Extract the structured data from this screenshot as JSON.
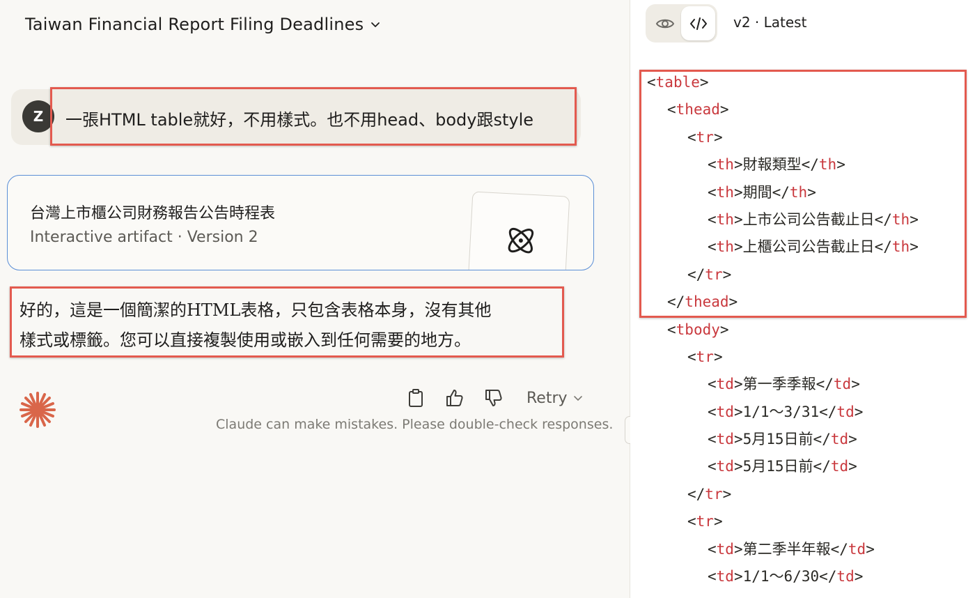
{
  "header": {
    "title": "Taiwan Financial Report Filing Deadlines"
  },
  "user_message": {
    "avatar_initial": "Z",
    "text": "一張HTML table就好，不用樣式。也不用head、body跟style"
  },
  "artifact_card": {
    "title": "台灣上市櫃公司財務報告公告時程表",
    "subtitle": "Interactive artifact · Version 2"
  },
  "assistant_message": {
    "lines": [
      "好的，這是一個簡潔的HTML表格，只包含表格本身，沒有其他",
      "樣式或標籤。您可以直接複製使用或嵌入到任何需要的地方。"
    ]
  },
  "actions": {
    "retry_label": "Retry",
    "disclaimer": "Claude can make mistakes. Please double-check responses.",
    "icons": [
      "copy-icon",
      "thumbs-up-icon",
      "thumbs-down-icon"
    ]
  },
  "code_panel": {
    "version_label": "v2 · Latest",
    "code_lines": [
      {
        "indent": 0,
        "open": true,
        "tag": "table"
      },
      {
        "indent": 1,
        "open": true,
        "tag": "thead"
      },
      {
        "indent": 2,
        "open": true,
        "tag": "tr"
      },
      {
        "indent": 3,
        "tag": "th",
        "text": "財報類型"
      },
      {
        "indent": 3,
        "tag": "th",
        "text": "期間"
      },
      {
        "indent": 3,
        "tag": "th",
        "text": "上市公司公告截止日"
      },
      {
        "indent": 3,
        "tag": "th",
        "text": "上櫃公司公告截止日"
      },
      {
        "indent": 2,
        "close": true,
        "tag": "tr"
      },
      {
        "indent": 1,
        "close": true,
        "tag": "thead"
      },
      {
        "indent": 1,
        "open": true,
        "tag": "tbody"
      },
      {
        "indent": 2,
        "open": true,
        "tag": "tr"
      },
      {
        "indent": 3,
        "tag": "td",
        "text": "第一季季報"
      },
      {
        "indent": 3,
        "tag": "td",
        "text": "1/1～3/31"
      },
      {
        "indent": 3,
        "tag": "td",
        "text": "5月15日前"
      },
      {
        "indent": 3,
        "tag": "td",
        "text": "5月15日前"
      },
      {
        "indent": 2,
        "close": true,
        "tag": "tr"
      },
      {
        "indent": 2,
        "open": true,
        "tag": "tr"
      },
      {
        "indent": 3,
        "tag": "td",
        "text": "第二季半年報"
      },
      {
        "indent": 3,
        "tag": "td",
        "text": "1/1～6/30"
      }
    ]
  },
  "colors": {
    "accent_highlight": "#e35a4f",
    "artifact_border": "#5a8ed6",
    "claude_spark": "#d9664a",
    "code_tag": "#c9383d"
  }
}
